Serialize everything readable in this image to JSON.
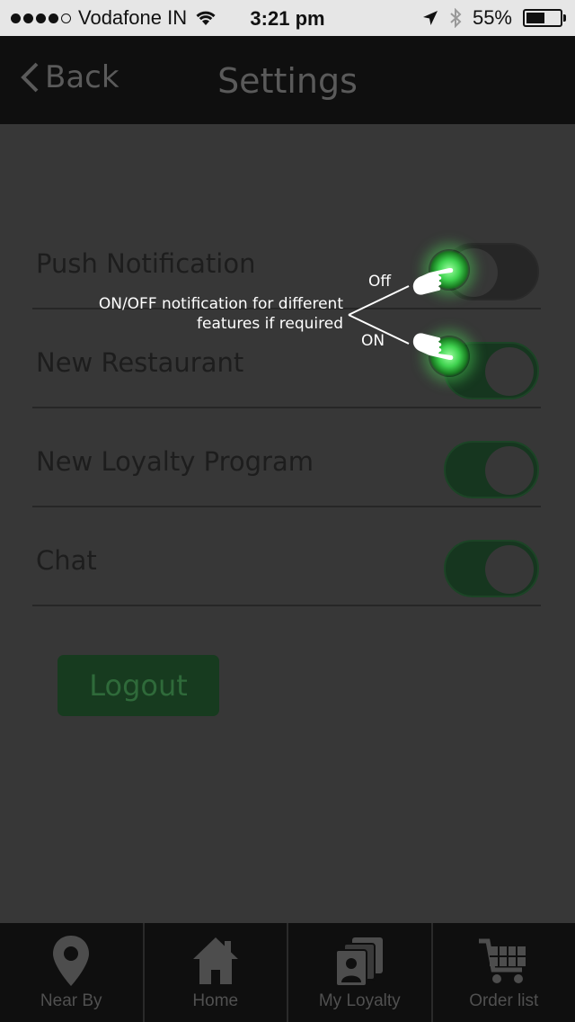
{
  "status_bar": {
    "carrier": "Vodafone IN",
    "time": "3:21 pm",
    "battery": "55%",
    "battery_level": 0.55,
    "signal_bars_filled": 4,
    "signal_bars_total": 5
  },
  "nav": {
    "back_label": "Back",
    "title": "Settings"
  },
  "settings": [
    {
      "label": "Push Notification",
      "state": "off"
    },
    {
      "label": "New Restaurant",
      "state": "on"
    },
    {
      "label": "New Loyalty Program",
      "state": "on"
    },
    {
      "label": "Chat",
      "state": "on"
    }
  ],
  "logout_label": "Logout",
  "annotations": {
    "main_line1": "ON/OFF notification for different",
    "main_line2": "features if required",
    "off_label": "Off",
    "on_label": "ON"
  },
  "tabs": [
    {
      "label": "Near By",
      "icon": "location-pin-icon"
    },
    {
      "label": "Home",
      "icon": "home-icon"
    },
    {
      "label": "My Loyalty",
      "icon": "loyalty-cards-icon"
    },
    {
      "label": "Order list",
      "icon": "shopping-cart-icon"
    }
  ],
  "colors": {
    "overlay_bg": "#373737",
    "toggle_on": "#16361f",
    "accent_green": "#3fd24f"
  }
}
